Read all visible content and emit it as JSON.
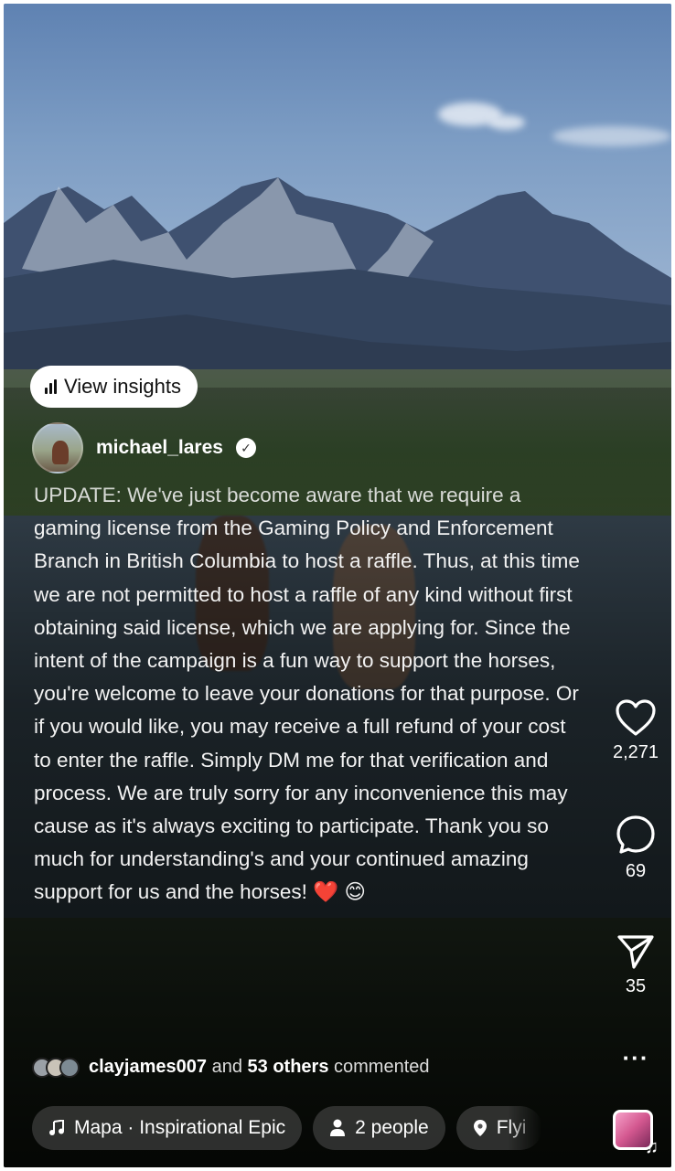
{
  "insights_button": {
    "label": "View insights"
  },
  "post": {
    "username": "michael_lares",
    "verified_symbol": "✓",
    "caption": "UPDATE:  We've just become aware that we require a gaming license from the Gaming Policy and Enforcement Branch in British Columbia to host a raffle. Thus, at this time we are not permitted to host a raffle of any kind without first obtaining said license, which we are applying for. Since the intent of the campaign is a fun way to support the horses, you're welcome to leave your donations for that purpose. Or if you would like, you may receive a full refund of your cost to enter the raffle. Simply DM me for that verification and process. We are truly sorry for any inconvenience this may cause as it's always exciting to participate. Thank you so much for understanding's and your continued amazing support for us and the horses! ❤️ 😊"
  },
  "actions": {
    "likes": "2,271",
    "comments": "69",
    "shares": "35",
    "more": "···"
  },
  "commenters": {
    "name": "clayjames007",
    "connector": "and",
    "others": "53 others",
    "suffix": "commented"
  },
  "chips": {
    "audio": "Mapa · Inspirational Epic",
    "people": "2 people",
    "location": "Flyi"
  },
  "colors": {
    "heart_outline": "#ffffff",
    "chip_background": "#505050",
    "insights_background": "#ffffff"
  },
  "icons": [
    "bar-chart-icon",
    "verified-icon",
    "heart-icon",
    "comment-icon",
    "share-icon",
    "more-icon",
    "music-note-icon",
    "person-icon",
    "location-pin-icon"
  ]
}
